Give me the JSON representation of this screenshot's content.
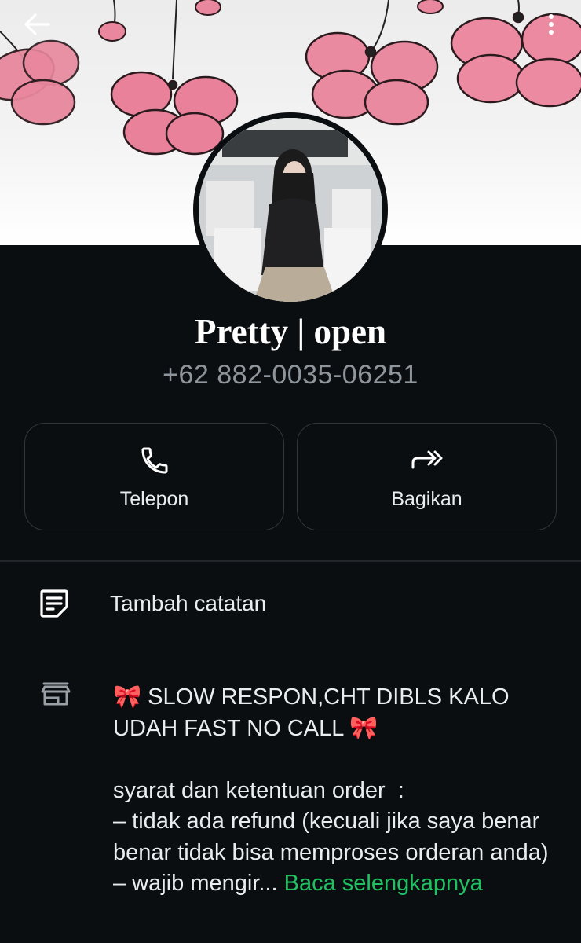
{
  "header": {
    "back_icon": "arrow-left-icon",
    "menu_icon": "more-vertical-icon"
  },
  "profile": {
    "name": "Pretty | open",
    "phone": "+62 882-0035-06251"
  },
  "actions": [
    {
      "label": "Telepon",
      "icon": "phone-icon"
    },
    {
      "label": "Bagikan",
      "icon": "share-forward-icon"
    }
  ],
  "note": {
    "label": "Tambah catatan",
    "icon": "note-icon"
  },
  "about": {
    "icon": "store-icon",
    "text": "🎀 SLOW RESPON,CHT DIBLS KALO UDAH FAST NO CALL 🎀\n\nsyarat dan ketentuan order  :\n– tidak ada refund (kecuali jika saya benar benar tidak bisa memproses orderan anda)\n– wajib mengir...",
    "read_more": "Baca selengkapnya"
  },
  "colors": {
    "background": "#0b0e11",
    "accent_green": "#21c063",
    "muted_text": "#8e969c",
    "card_border": "#30363a"
  }
}
